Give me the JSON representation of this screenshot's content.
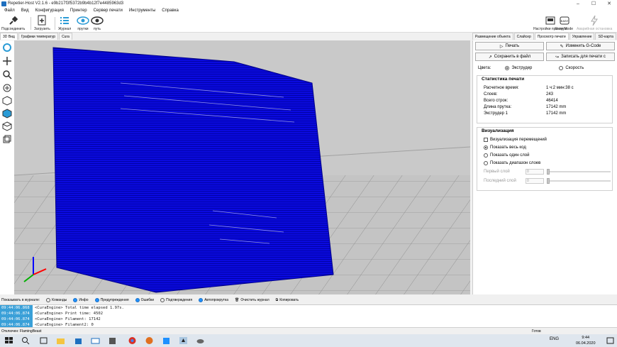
{
  "window": {
    "title": "Repetier-Host V2.1.6 - e9b217f3f5372b9b4b12f7e4485963d3"
  },
  "menu": [
    "Файл",
    "Вид",
    "Конфигурация",
    "Принтер",
    "Сервер печати",
    "Инструменты",
    "Справка"
  ],
  "toolbar": {
    "connect": "Подсоединить",
    "load": "Загрузить",
    "log": "Журнал",
    "filament": "прутки",
    "path": "путь",
    "printer_settings": "Настройки принтера",
    "easy_mode": "Easy Mode",
    "emergency": "Аварийная остановка"
  },
  "left_tabs": [
    "3D Вид",
    "Графики температур",
    "Cura"
  ],
  "right_tabs": [
    "Размещение объекта",
    "Слайсер",
    "Просмотр печати",
    "Управление",
    "SD-карта"
  ],
  "preview": {
    "print_btn": "Печать",
    "edit_gcode_btn": "Изменить G-Code",
    "save_file_btn": "Сохранить в файл",
    "save_print_btn": "Записать для печати с",
    "colors_label": "Цвета:",
    "color_extruder": "Экструдер",
    "color_speed": "Скорость",
    "stats_title": "Статистика печати",
    "stats": [
      {
        "label": "Расчетное время:",
        "value": "1 ч:2 мин:38 с"
      },
      {
        "label": "Слоев:",
        "value": "243"
      },
      {
        "label": "Всего строк:",
        "value": "46414"
      },
      {
        "label": "Длина прутка:",
        "value": "17142 mm"
      },
      {
        "label": "Экструдер 1",
        "value": "17142 mm"
      }
    ],
    "vis_title": "Визуализация",
    "vis_travel": "Визуализация перемещений",
    "vis_all": "Показать весь код",
    "vis_one": "Показать один слой",
    "vis_range": "Показать диапазон слоев",
    "first_layer": "Первый слой",
    "last_layer": "Последний слой",
    "first_val": "0",
    "last_val": "0"
  },
  "logbar": {
    "show_label": "Показывать в журнале:",
    "commands": "Команды",
    "info": "Инфо",
    "warnings": "Предупреждения",
    "errors": "Ошибки",
    "acks": "Подтверждения",
    "autoscroll": "Автопрокрутка",
    "clear": "Очистить журнал",
    "copy": "Копировать"
  },
  "log": [
    {
      "time": "09:44:06.868",
      "msg": "<CuraEngine> Total time elapsed  1.97s."
    },
    {
      "time": "09:44:06.874",
      "msg": "<CuraEngine> Print time: 4502"
    },
    {
      "time": "09:44:06.874",
      "msg": "<CuraEngine> Filament: 17142"
    },
    {
      "time": "09:44:06.874",
      "msg": "<CuraEngine> Filament2: 0"
    }
  ],
  "status": {
    "left": "Отключен: FlamingBeast",
    "middle": "Готов"
  },
  "taskbar": {
    "lang": "ENG",
    "time": "9:44",
    "date": "06.04.2020"
  }
}
